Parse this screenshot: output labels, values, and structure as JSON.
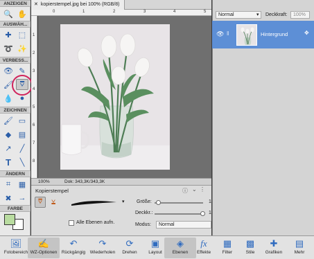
{
  "toolbox": {
    "sections": [
      "ANZEIGEN",
      "AUSWÄH...",
      "VERBESS...",
      "ZEICHNEN",
      "ÄNDERN",
      "FARBE"
    ]
  },
  "document": {
    "tab_title": "kopierstempel.jpg bei 100% (RGB/8)",
    "zoom": "100%",
    "doc_size": "Dok: 343,3K/343,3K",
    "ruler_top": [
      "0",
      "1",
      "2",
      "3",
      "4",
      "5"
    ],
    "ruler_left": [
      "1",
      "2",
      "3",
      "4",
      "5",
      "6",
      "7",
      "8"
    ]
  },
  "tool_options": {
    "tool_name": "Kopierstempel",
    "size_label": "Größe:",
    "size_value": 1,
    "opacity_label": "Deckkr.:",
    "opacity_value": 1,
    "mode_label": "Modus:",
    "mode_value": "Normal",
    "align_checkbox": "Alle Ebenen aufn."
  },
  "layers_panel": {
    "blend_mode": "Normal",
    "opacity_label": "Deckkraft:",
    "opacity_value": "100%",
    "layer_name": "Hintergrund"
  },
  "bottom_bar": {
    "buttons": [
      "Fotobereich",
      "WZ-Optionen",
      "Rückgängig",
      "Wiederholen",
      "Drehen",
      "Layout",
      "Ebenen",
      "Effekte",
      "Filter",
      "Stile",
      "Grafiken",
      "Mehr"
    ]
  },
  "colors": {
    "accent": "#5d8fd6",
    "foreground_swatch": "#b9dca0",
    "background_swatch": "#ffffff",
    "highlight_ring": "#d0245c"
  }
}
